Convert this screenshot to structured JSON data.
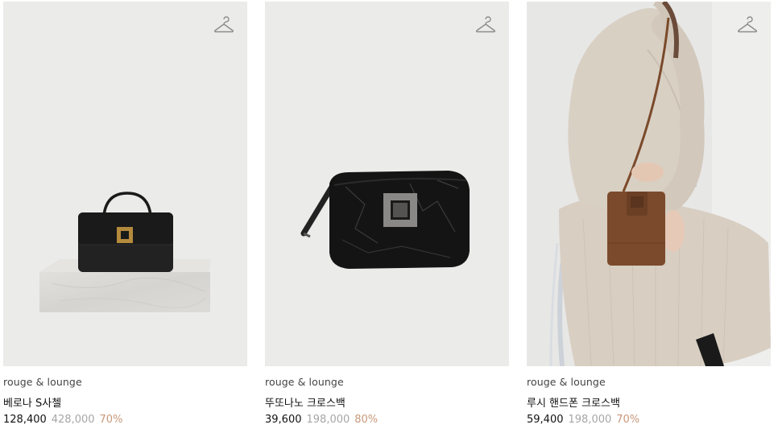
{
  "products": [
    {
      "brand": "rouge & lounge",
      "name": "베로나 S사첼",
      "price": "128,400",
      "original_price": "428,000",
      "discount": "70%",
      "wishlist_icon": "hanger-icon",
      "image": "black-satchel-bag-on-marble-block"
    },
    {
      "brand": "rouge & lounge",
      "name": "뚜또나노 크로스백",
      "price": "39,600",
      "original_price": "198,000",
      "discount": "80%",
      "wishlist_icon": "hanger-icon",
      "image": "black-crinkled-crossbody-bag"
    },
    {
      "brand": "rouge & lounge",
      "name": "루시 핸드폰 크로스백",
      "price": "59,400",
      "original_price": "198,000",
      "discount": "70%",
      "wishlist_icon": "hanger-icon",
      "image": "model-with-brown-phone-crossbody-bag"
    }
  ],
  "colors": {
    "price": "#111111",
    "original_price": "#a6a6a6",
    "discount": "#c8987a",
    "photo_background": "#ebebea"
  }
}
